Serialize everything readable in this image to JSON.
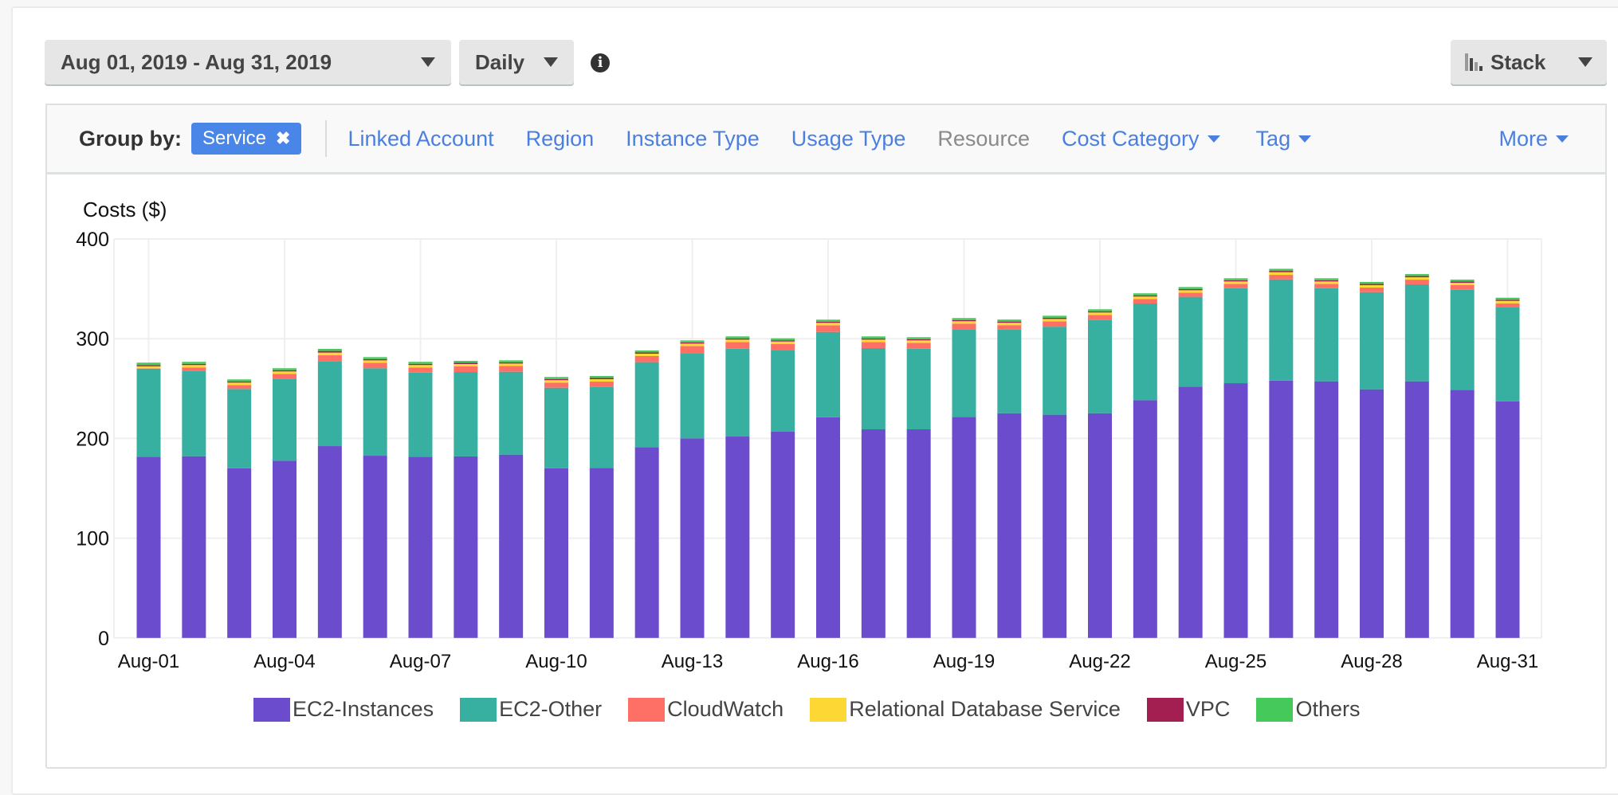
{
  "toolbar": {
    "date_range": "Aug 01, 2019 - Aug 31, 2019",
    "granularity": "Daily",
    "info_icon": "info-circle-icon",
    "chart_style": "Stack",
    "chart_style_icon": "bar-chart-icon"
  },
  "group_by": {
    "label": "Group by:",
    "selected_chip": "Service",
    "remove_icon": "close-icon",
    "options": [
      {
        "label": "Linked Account",
        "dropdown": false,
        "enabled": true
      },
      {
        "label": "Region",
        "dropdown": false,
        "enabled": true
      },
      {
        "label": "Instance Type",
        "dropdown": false,
        "enabled": true
      },
      {
        "label": "Usage Type",
        "dropdown": false,
        "enabled": true
      },
      {
        "label": "Resource",
        "dropdown": false,
        "enabled": false
      },
      {
        "label": "Cost Category",
        "dropdown": true,
        "enabled": true
      },
      {
        "label": "Tag",
        "dropdown": true,
        "enabled": true
      }
    ],
    "more_label": "More"
  },
  "colors": {
    "EC2-Instances": "#6a4ccc",
    "EC2-Other": "#37b0a2",
    "CloudWatch": "#fe6f65",
    "Relational Database Service": "#fdd835",
    "VPC": "#a31f52",
    "Others": "#45c95b",
    "link": "#4a7fe0",
    "chip": "#4a86e8"
  },
  "chart_data": {
    "type": "bar",
    "stacked": true,
    "title": "",
    "ylabel": "Costs ($)",
    "xlabel": "",
    "ylim": [
      0,
      400
    ],
    "yticks": [
      0,
      100,
      200,
      300,
      400
    ],
    "grid": true,
    "legend_position": "bottom",
    "categories": [
      "Aug-01",
      "Aug-02",
      "Aug-03",
      "Aug-04",
      "Aug-05",
      "Aug-06",
      "Aug-07",
      "Aug-08",
      "Aug-09",
      "Aug-10",
      "Aug-11",
      "Aug-12",
      "Aug-13",
      "Aug-14",
      "Aug-15",
      "Aug-16",
      "Aug-17",
      "Aug-18",
      "Aug-19",
      "Aug-20",
      "Aug-21",
      "Aug-22",
      "Aug-23",
      "Aug-24",
      "Aug-25",
      "Aug-26",
      "Aug-27",
      "Aug-28",
      "Aug-29",
      "Aug-30",
      "Aug-31"
    ],
    "xtick_labels": [
      "Aug-01",
      "Aug-04",
      "Aug-07",
      "Aug-10",
      "Aug-13",
      "Aug-16",
      "Aug-19",
      "Aug-22",
      "Aug-25",
      "Aug-28",
      "Aug-31"
    ],
    "series": [
      {
        "name": "EC2-Instances",
        "values": [
          181.7,
          182.2,
          170.2,
          177.7,
          192.3,
          182.7,
          181.7,
          182.0,
          183.8,
          170.2,
          170.5,
          191.3,
          200.1,
          201.9,
          206.7,
          221.3,
          209.1,
          209.1,
          221.6,
          225.3,
          223.8,
          225.3,
          238.4,
          252.0,
          255.4,
          258.0,
          257.3,
          249.3,
          257.3,
          248.8,
          237.3
        ]
      },
      {
        "name": "EC2-Other",
        "values": [
          88.3,
          85.5,
          79.4,
          82.3,
          85.0,
          87.7,
          84.3,
          84.6,
          83.1,
          80.7,
          81.2,
          85.2,
          85.4,
          88.1,
          81.5,
          85.5,
          81.5,
          80.9,
          87.9,
          83.9,
          88.2,
          93.5,
          96.9,
          90.0,
          95.3,
          101.5,
          93.4,
          97.4,
          97.2,
          100.3,
          94.0
        ]
      },
      {
        "name": "CloudWatch",
        "values": [
          0.4,
          3.5,
          4.0,
          4.8,
          6.1,
          5.5,
          5.2,
          5.6,
          5.8,
          5.1,
          5.3,
          6.1,
          7.2,
          6.7,
          6.6,
          6.7,
          6.1,
          5.9,
          5.6,
          4.4,
          5.4,
          5.1,
          4.6,
          4.2,
          4.3,
          4.5,
          4.3,
          4.6,
          4.7,
          4.6,
          4.2
        ]
      },
      {
        "name": "Relational Database Service",
        "values": [
          1.9,
          2.4,
          2.4,
          2.4,
          2.7,
          2.4,
          2.4,
          2.4,
          2.4,
          2.4,
          2.4,
          2.4,
          2.4,
          2.4,
          2.4,
          2.4,
          2.4,
          2.4,
          2.4,
          2.4,
          2.4,
          2.4,
          2.4,
          2.4,
          2.4,
          2.7,
          2.4,
          2.4,
          2.4,
          2.4,
          2.4
        ]
      },
      {
        "name": "VPC",
        "values": [
          1.2,
          1.2,
          1.2,
          1.2,
          1.6,
          1.2,
          1.2,
          1.2,
          1.2,
          1.2,
          1.2,
          1.2,
          1.2,
          1.2,
          1.2,
          1.2,
          1.2,
          1.2,
          1.2,
          1.2,
          1.2,
          1.2,
          1.2,
          1.2,
          1.2,
          1.3,
          1.2,
          1.2,
          1.2,
          1.2,
          1.2
        ]
      },
      {
        "name": "Others",
        "values": [
          2.5,
          2.0,
          2.0,
          2.0,
          2.1,
          2.0,
          2.0,
          2.0,
          2.0,
          2.0,
          2.0,
          2.0,
          2.0,
          2.0,
          2.0,
          2.0,
          2.0,
          2.0,
          2.0,
          2.0,
          2.0,
          2.0,
          2.0,
          2.0,
          2.0,
          2.1,
          2.0,
          2.0,
          2.0,
          2.0,
          2.0
        ]
      }
    ]
  }
}
